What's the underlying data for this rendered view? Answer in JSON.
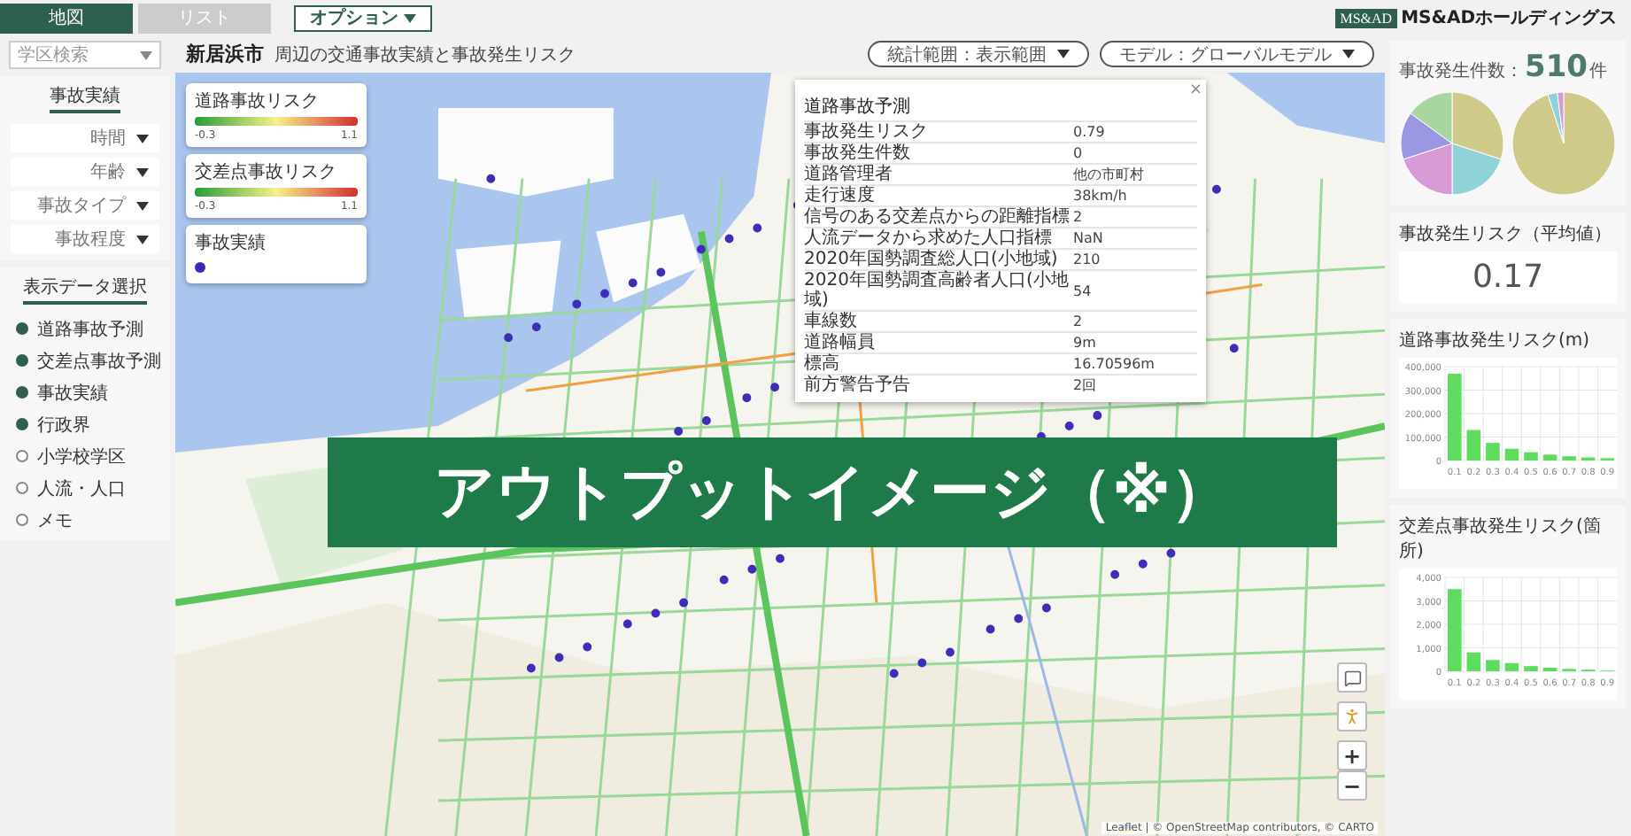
{
  "tabs": [
    {
      "label": "地図",
      "selected": true
    },
    {
      "label": "リスト",
      "selected": false
    }
  ],
  "options_button": {
    "label": "オプション"
  },
  "logo": {
    "mark": "MS&AD",
    "name": "MS&ADホールディングス"
  },
  "sidebar": {
    "search": {
      "placeholder": "学区検索"
    },
    "accident_section": {
      "title": "事故実績",
      "filters": [
        "時間",
        "年齢",
        "事故タイプ",
        "事故程度"
      ]
    },
    "display_section": {
      "title": "表示データ選択",
      "items": [
        {
          "label": "道路事故予測",
          "on": true
        },
        {
          "label": "交差点事故予測",
          "on": true
        },
        {
          "label": "事故実績",
          "on": true
        },
        {
          "label": "行政界",
          "on": true
        },
        {
          "label": "小学校学区",
          "on": false
        },
        {
          "label": "人流・人口",
          "on": false
        },
        {
          "label": "メモ",
          "on": false
        }
      ]
    }
  },
  "header": {
    "city": "新居浜市",
    "subtitle": "周辺の交通事故実績と事故発生リスク",
    "selectors": [
      "統計範囲：表示範囲",
      "モデル：グローバルモデル"
    ]
  },
  "map": {
    "legends": [
      {
        "kind": "gradient",
        "title": "道路事故リスク",
        "min": "-0.3",
        "max": "1.1"
      },
      {
        "kind": "gradient",
        "title": "交差点事故リスク",
        "min": "-0.3",
        "max": "1.1"
      },
      {
        "kind": "dot",
        "title": "事故実績"
      }
    ],
    "popup": {
      "close": "×",
      "title": "道路事故予測",
      "rows": [
        {
          "label": "事故発生リスク",
          "value": "0.79"
        },
        {
          "label": "事故発生件数",
          "value": "0"
        },
        {
          "label": "道路管理者",
          "value": "他の市町村"
        },
        {
          "label": "走行速度",
          "value": "38km/h"
        },
        {
          "label": "信号のある交差点からの距離指標",
          "value": "2"
        },
        {
          "label": "人流データから求めた人口指標",
          "value": "NaN"
        },
        {
          "label": "2020年国勢調査総人口(小地域)",
          "value": "210"
        },
        {
          "label": "2020年国勢調査高齢者人口(小地域)",
          "value": "54"
        },
        {
          "label": "車線数",
          "value": "2"
        },
        {
          "label": "道路幅員",
          "value": "9m"
        },
        {
          "label": "標高",
          "value": "16.70596m"
        },
        {
          "label": "前方警告予告",
          "value": "2回"
        }
      ]
    },
    "controls": {
      "zoom_in": "+",
      "zoom_out": "−"
    },
    "attribution": "Leaflet | © OpenStreetMap contributors, © CARTO"
  },
  "banner": "アウトプットイメージ（※）",
  "stats": {
    "count_label": "事故発生件数：",
    "count": "510",
    "count_unit": "件",
    "risk_title": "事故発生リスク（平均値）",
    "risk_value": "0.17",
    "charts": [
      {
        "chart_data": {
          "type": "bar",
          "title": "道路事故発生リスク(m)",
          "categories": [
            "0.1",
            "0.2",
            "0.3",
            "0.4",
            "0.5",
            "0.6",
            "0.7",
            "0.8",
            "0.9"
          ],
          "series": [
            {
              "color": "#5ddc5d",
              "values": [
                370000,
                130000,
                75000,
                50000,
                35000,
                25000,
                18000,
                13000,
                10000
              ]
            }
          ],
          "grid": true,
          "ylim": [
            0,
            400000
          ],
          "yticks": [
            {
              "value": 0,
              "label": "0"
            },
            {
              "value": 100000,
              "label": "100,000"
            },
            {
              "value": 200000,
              "label": "200,000"
            },
            {
              "value": 300000,
              "label": "300,000"
            },
            {
              "value": 400000,
              "label": "400,000"
            }
          ]
        }
      },
      {
        "chart_data": {
          "type": "bar",
          "title": "交差点事故発生リスク(箇所)",
          "categories": [
            "0.1",
            "0.2",
            "0.3",
            "0.4",
            "0.5",
            "0.6",
            "0.7",
            "0.8",
            "0.9"
          ],
          "series": [
            {
              "color": "#5ddc5d",
              "values": [
                3500,
                800,
                480,
                350,
                220,
                150,
                100,
                70,
                30
              ]
            }
          ],
          "grid": true,
          "ylim": [
            0,
            4000
          ],
          "yticks": [
            {
              "value": 0,
              "label": "0"
            },
            {
              "value": 1000,
              "label": "1,000"
            },
            {
              "value": 2000,
              "label": "2,000"
            },
            {
              "value": 3000,
              "label": "3,000"
            },
            {
              "value": 4000,
              "label": "4,000"
            }
          ]
        }
      }
    ]
  }
}
